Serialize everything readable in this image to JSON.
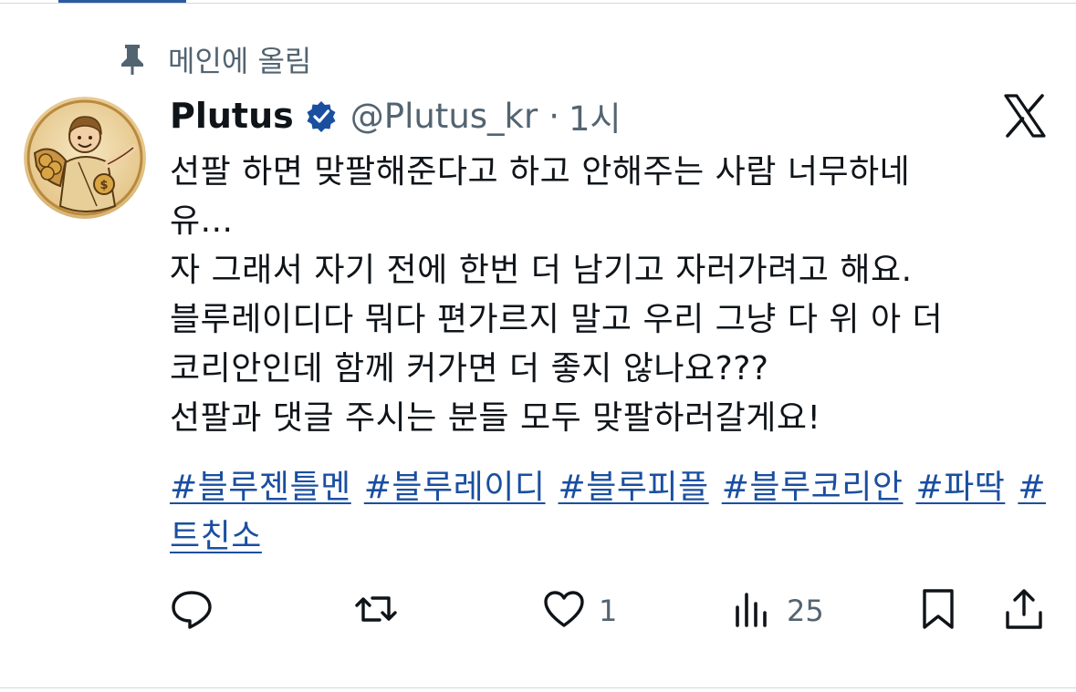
{
  "pinned": {
    "label": "메인에 올림",
    "icon": "pin-icon"
  },
  "author": {
    "display_name": "Plutus",
    "handle": "@Plutus_kr",
    "separator": "·",
    "time": "1시",
    "verified": true,
    "avatar": "plutus-cartoon-avatar"
  },
  "platform": {
    "icon": "x-logo-icon"
  },
  "post": {
    "lines": [
      "선팔 하면 맞팔해준다고 하고 안해주는 사람 너무하네",
      "유...",
      "자 그래서 자기 전에 한번 더 남기고 자러가려고 해요.",
      "블루레이디다 뭐다 편가르지 말고 우리 그냥 다 위 아 더",
      "코리안인데 함께 커가면 더 좋지 않나요???",
      "선팔과 댓글 주시는 분들 모두 맞팔하러갈게요!"
    ],
    "hashtags": [
      "#블루젠틀멘",
      "#블루레이디",
      "#블루피플",
      "#블루코리안",
      "#파딱",
      "#트친소"
    ]
  },
  "actions": {
    "reply": {
      "icon": "reply-icon",
      "count": ""
    },
    "repost": {
      "icon": "repost-icon",
      "count": ""
    },
    "like": {
      "icon": "heart-icon",
      "count": "1"
    },
    "views": {
      "icon": "views-icon",
      "count": "25"
    },
    "bookmark": {
      "icon": "bookmark-icon"
    },
    "share": {
      "icon": "share-icon"
    }
  },
  "colors": {
    "link": "#1a4fa0",
    "muted": "#536471",
    "verified": "#1a4fa0",
    "text": "#0f1419"
  }
}
